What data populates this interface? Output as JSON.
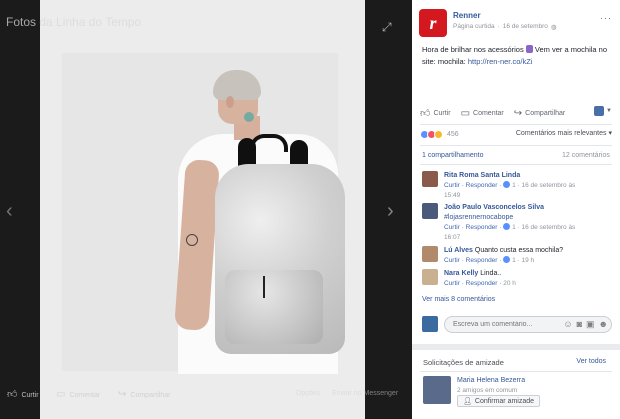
{
  "viewer": {
    "title": "Fotos da Linha do Tempo",
    "footer": {
      "like": "Curtir",
      "comment": "Comentar",
      "share": "Compartilhar",
      "options": "Opções",
      "send_messenger": "Enviar no Messenger"
    }
  },
  "post": {
    "page_name": "Renner",
    "logo_letter": "r",
    "page_type": "Página curtida",
    "date": "16 de setembro",
    "privacy_icon": "globe-icon",
    "text_line1": "Hora de brilhar nos acessórios",
    "text_line2": " Vem ver a mochila no site: mochila: ",
    "link": "http://ren-ner.co/kZi",
    "actions": {
      "like": "Curtir",
      "comment": "Comentar",
      "share": "Compartilhar"
    },
    "reactions_count": "456",
    "relevance_label": "Comentários mais relevantes",
    "shares": "1 compartilhamento",
    "comments_count": "12 comentários",
    "more_comments": "Ver mais 8 comentários",
    "composer_placeholder": "Escreva um comentário..."
  },
  "comments": [
    {
      "name": "Rita Roma Santa Linda",
      "text": "",
      "tag": "",
      "reply": "Curtir · Responder ·",
      "likes": "1",
      "time": "· 16 de setembro às",
      "time2": "15:49"
    },
    {
      "name": "João Paulo Vasconcelos Silva",
      "text": "",
      "tag": "#lojasrennernocabope",
      "reply": "Curtir · Responder ·",
      "likes": "1",
      "time": "· 16 de setembro às",
      "time2": "16:07"
    },
    {
      "name": "Lú Alves",
      "text": "Quanto custa essa mochila?",
      "tag": "",
      "reply": "Curtir · Responder ·",
      "likes": "1",
      "time": "· 19 h",
      "time2": ""
    },
    {
      "name": "Nara Kelly",
      "text": "Linda..",
      "tag": "",
      "reply": "Curtir · Responder ·",
      "likes": "",
      "time": "20 h",
      "time2": ""
    }
  ],
  "friends": {
    "title": "Solicitações de amizade",
    "see_all": "Ver todos",
    "name": "Maria Helena Bezerra",
    "mutual": "2 amigos em comum",
    "confirm": "Confirmar amizade"
  },
  "colors": {
    "link_blue": "#365899",
    "renner_red": "#d4181f",
    "like_blue": "#5890ff",
    "love_red": "#f25268",
    "haha_yellow": "#f7b928"
  }
}
